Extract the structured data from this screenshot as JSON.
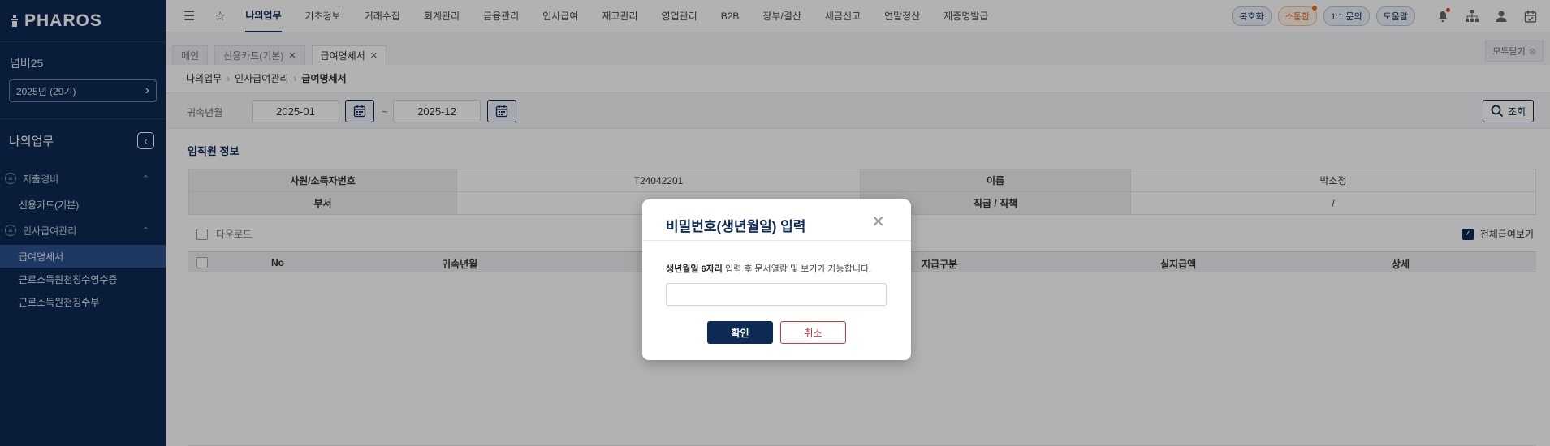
{
  "brand": {
    "name": "PHAROS"
  },
  "sidebar": {
    "company": "넘버25",
    "year_select": "2025년 (29기)",
    "section_title": "나의업무",
    "groups": [
      {
        "label": "지출경비",
        "items": [
          "신용카드(기본)"
        ]
      },
      {
        "label": "인사급여관리",
        "items": [
          "급여명세서",
          "근로소득원천징수영수증",
          "근로소득원천징수부"
        ]
      }
    ],
    "active_item": "급여명세서"
  },
  "topnav": {
    "items": [
      "나의업무",
      "기초정보",
      "거래수집",
      "회계관리",
      "금융관리",
      "인사급여",
      "재고관리",
      "영업관리",
      "B2B",
      "장부/결산",
      "세금신고",
      "연말정산",
      "제증명발급"
    ],
    "active": "나의업무",
    "pills": [
      "복호화",
      "소통함",
      "1:1 문의",
      "도움말"
    ],
    "icons": [
      "bell-icon",
      "org-chart-icon",
      "user-icon",
      "calendar-check-icon"
    ]
  },
  "tabs": {
    "items": [
      {
        "label": "메인",
        "closable": false
      },
      {
        "label": "신용카드(기본)",
        "closable": true
      },
      {
        "label": "급여명세서",
        "closable": true,
        "active": true
      }
    ],
    "close_all": "모두닫기"
  },
  "breadcrumb": [
    "나의업무",
    "인사급여관리",
    "급여명세서"
  ],
  "filter": {
    "label": "귀속년월",
    "from": "2025-01",
    "to": "2025-12",
    "dash": "~",
    "search": "조회"
  },
  "employee": {
    "title": "임직원 정보",
    "rows": [
      {
        "k1": "사원/소득자번호",
        "v1": "T24042201",
        "k2": "이름",
        "v2": "박소정"
      },
      {
        "k1": "부서",
        "v1": "",
        "k2": "직급 / 직책",
        "v2": "/"
      }
    ]
  },
  "grid": {
    "download": "다운로드",
    "view_all": "전체급여보기",
    "columns": [
      "No",
      "귀속년월",
      "지급구분",
      "실지급액",
      "상세"
    ]
  },
  "modal": {
    "title": "비밀번호(생년월일) 입력",
    "desc_bold": "생년월일 6자리",
    "desc_rest": " 입력 후 문서열람 및 보기가 가능합니다.",
    "confirm": "확인",
    "cancel": "취소"
  },
  "colors": {
    "primary": "#0d2a55",
    "danger": "#d23b3b",
    "accent_orange": "#e66a1f"
  }
}
